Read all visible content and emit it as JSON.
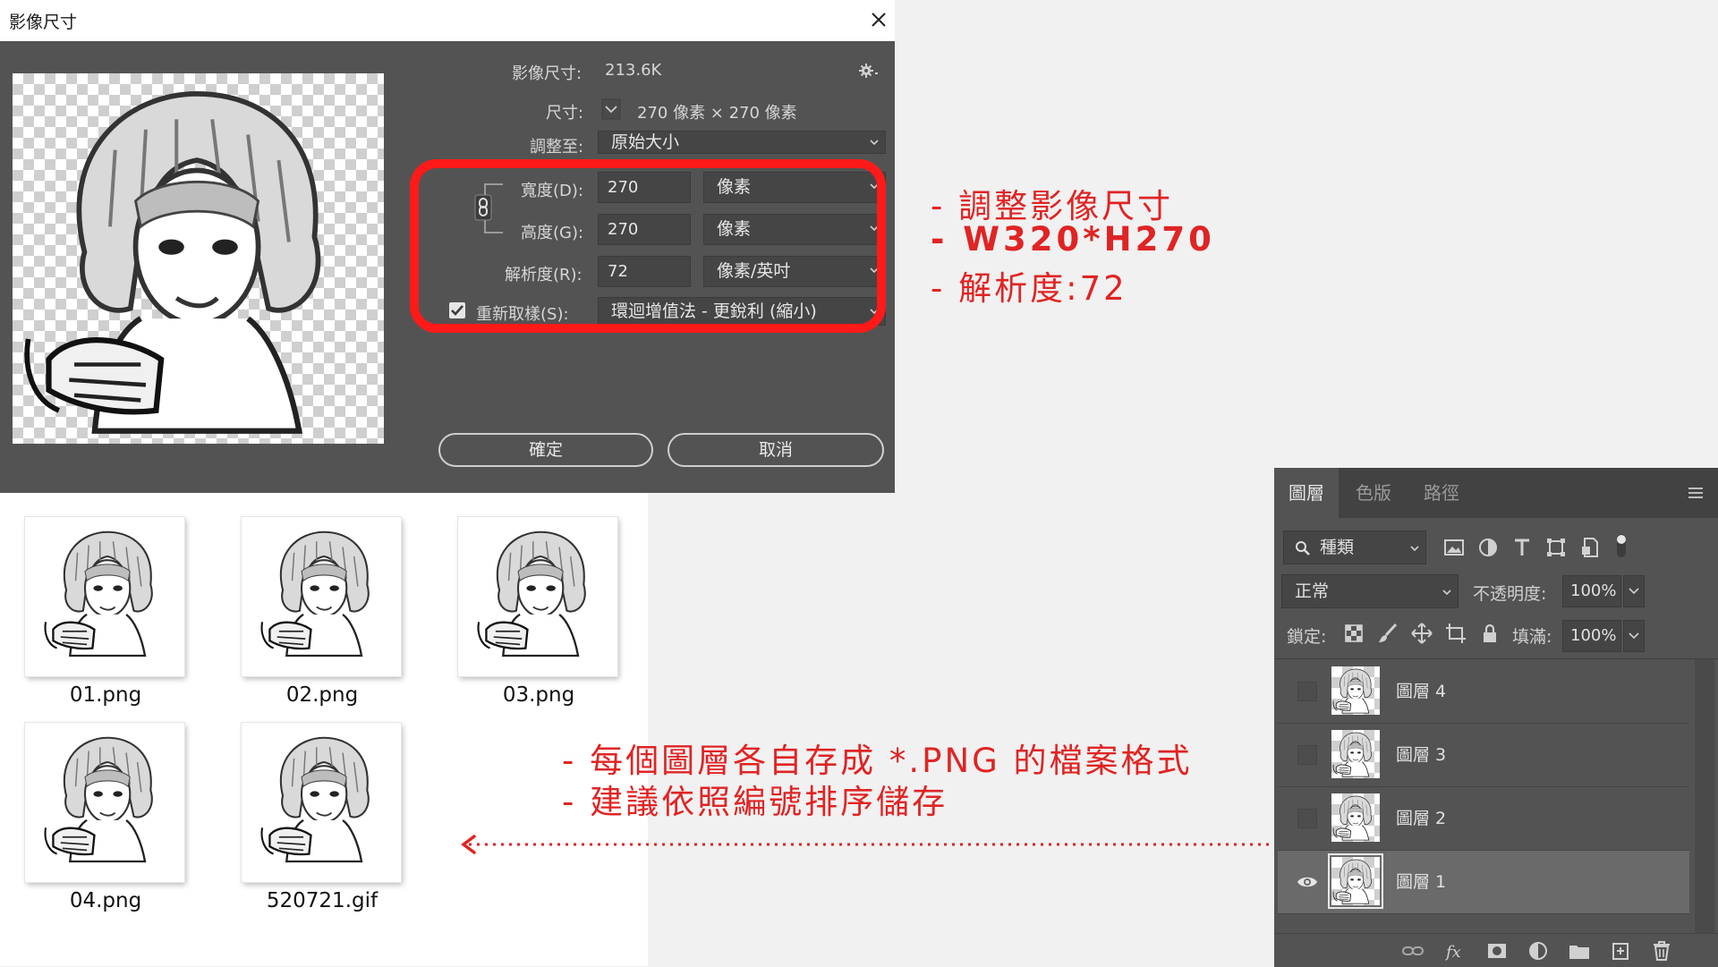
{
  "dialog": {
    "title": "影像尺寸",
    "image_size_label": "影像尺寸:",
    "image_size_value": "213.6K",
    "dimensions_label": "尺寸:",
    "dimensions_value": "270 像素 × 270 像素",
    "fit_to_label": "調整至:",
    "fit_to_value": "原始大小",
    "width_label": "寬度(D):",
    "width_value": "270",
    "width_unit": "像素",
    "height_label": "高度(G):",
    "height_value": "270",
    "height_unit": "像素",
    "resolution_label": "解析度(R):",
    "resolution_value": "72",
    "resolution_unit": "像素/英吋",
    "resample_label": "重新取樣(S):",
    "resample_checked": true,
    "resample_value": "環迴增值法 - 更銳利 (縮小)",
    "ok_label": "確定",
    "cancel_label": "取消"
  },
  "annotations": {
    "resize_notes": [
      "- 調整影像尺寸",
      "- W320*H270",
      "- 解析度:72"
    ],
    "export_notes": [
      "- 每個圖層各自存成 *.PNG 的檔案格式",
      "- 建議依照編號排序儲存"
    ],
    "accent_color": "#e02424"
  },
  "files": [
    {
      "name": "01.png"
    },
    {
      "name": "02.png"
    },
    {
      "name": "03.png"
    },
    {
      "name": "04.png"
    },
    {
      "name": "520721.gif"
    }
  ],
  "layers_panel": {
    "tabs": [
      "圖層",
      "色版",
      "路徑"
    ],
    "active_tab": 0,
    "filter_label": "種類",
    "blend_mode": "正常",
    "opacity_label": "不透明度:",
    "opacity_value": "100%",
    "lock_label": "鎖定:",
    "fill_label": "填滿:",
    "fill_value": "100%",
    "layers": [
      {
        "name": "圖層 4",
        "visible": false,
        "selected": false
      },
      {
        "name": "圖層 3",
        "visible": false,
        "selected": false
      },
      {
        "name": "圖層 2",
        "visible": false,
        "selected": false
      },
      {
        "name": "圖層 1",
        "visible": true,
        "selected": true
      }
    ]
  }
}
